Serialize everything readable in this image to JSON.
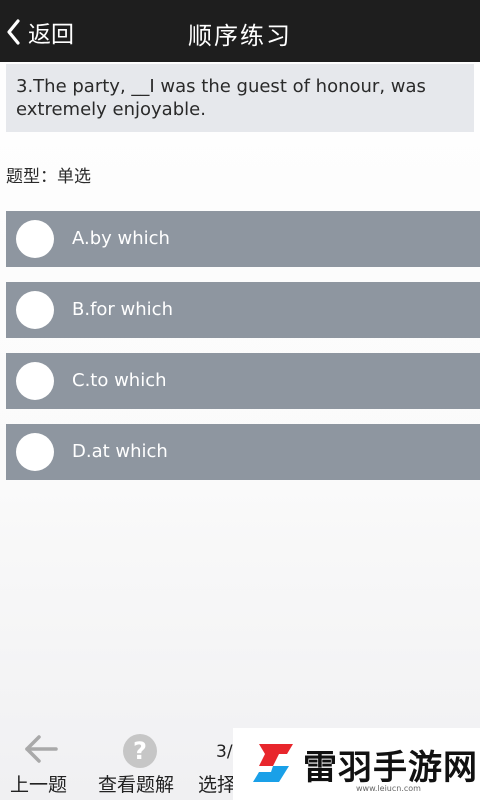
{
  "header": {
    "back_label": "返回",
    "title": "顺序练习"
  },
  "question": {
    "text": "3.The party, __I was the guest of honour, was extremely enjoyable.",
    "type_label": "题型：单选"
  },
  "options": [
    {
      "label": "A.by which"
    },
    {
      "label": "B.for which"
    },
    {
      "label": "C.to which"
    },
    {
      "label": "D.at which"
    }
  ],
  "footer": {
    "prev_label": "上一题",
    "explain_label": "查看题解",
    "choose_label": "选择",
    "progress": "3/"
  },
  "watermark": {
    "text": "雷羽手游网",
    "url": "www.leiucn.com"
  },
  "colors": {
    "header_bg": "#1e1e1e",
    "option_bg": "#8e96a0",
    "question_bg": "#e6e8ec",
    "watermark_red": "#e8262c",
    "watermark_blue": "#1aa0e8"
  },
  "icons": [
    "chevron-left-icon",
    "arrow-left-icon",
    "question-mark-icon",
    "radio-icon",
    "watermark-logo-icon"
  ]
}
